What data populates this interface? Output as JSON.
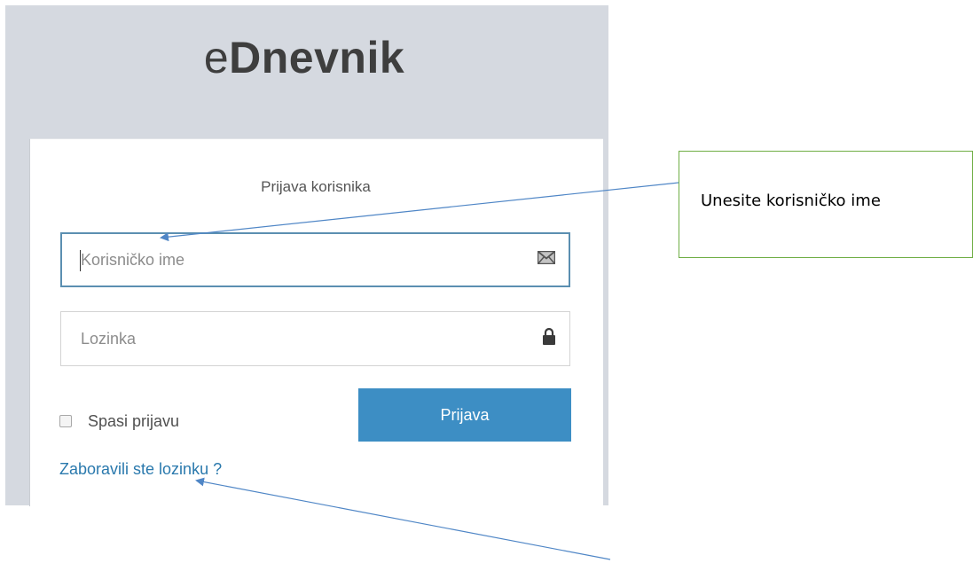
{
  "brand": {
    "prefix": "e",
    "name": "Dnevnik"
  },
  "login": {
    "title": "Prijava korisnika",
    "username": {
      "placeholder": "Korisničko ime",
      "value": ""
    },
    "password": {
      "placeholder": "Lozinka",
      "value": ""
    },
    "remember_label": "Spasi prijavu",
    "submit_label": "Prijava",
    "forgot_label": "Zaboravili ste lozinku ?"
  },
  "annotation": {
    "callout_text": "Unesite korisničko ime"
  },
  "icons": {
    "username": "envelope-icon",
    "password": "lock-icon"
  },
  "colors": {
    "accent": "#3d8ec4",
    "link": "#2a79ad",
    "callout_border": "#6fae44",
    "arrow": "#4f86c6"
  }
}
